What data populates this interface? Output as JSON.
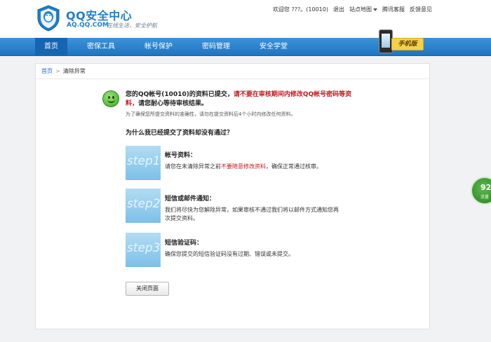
{
  "header": {
    "logo_title": "QQ安全中心",
    "logo_domain": "AQ.QQ.COM",
    "logo_slogan": "在线生活，安全护航",
    "top_links": {
      "welcome": "欢迎您 ???。(10010)",
      "logout": "退出",
      "sitemap": "站点地图",
      "support": "腾讯客服",
      "feedback": "反馈意见"
    }
  },
  "nav": {
    "items": [
      "首页",
      "密保工具",
      "帐号保护",
      "密码管理",
      "安全学堂"
    ],
    "phone_badge": "手机版"
  },
  "breadcrumb": {
    "home": "首页",
    "separator": ">",
    "current": "清除异常"
  },
  "message": {
    "part1": "您的QQ帐号(10010)的资料已提交，",
    "warning": "请不要在审核期间内修改QQ帐号密码等资料，",
    "part2": "请您耐心等待审核结果。",
    "note": "为了确保您所提交资料的准确性，请勿在提交资料后4个小时内修改任何资料。"
  },
  "why_title": "为什么我已经提交了资料却没有通过？",
  "steps": [
    {
      "image_text": "step1",
      "title": "帐号资料：",
      "desc_before": "请您在未清除异常之前",
      "desc_highlight": "不要随意修改资料",
      "desc_after": "，确保正常通过核审。"
    },
    {
      "image_text": "step2",
      "title": "短信或邮件通知：",
      "desc": "我们将尽快为您解除异常，如果审核不通过我们将以邮件方式通知您再次提交资料。"
    },
    {
      "image_text": "step3",
      "title": "短信验证码：",
      "desc": "确保您提交的短信验证码没有过期、错误或未提交。"
    }
  ],
  "close_button": "关闭页面",
  "side_widget": {
    "number": "92",
    "label": "流量"
  },
  "colors": {
    "nav_blue": "#2a80c8",
    "warning_red": "#c4161c",
    "link_blue": "#1f6ebc"
  }
}
